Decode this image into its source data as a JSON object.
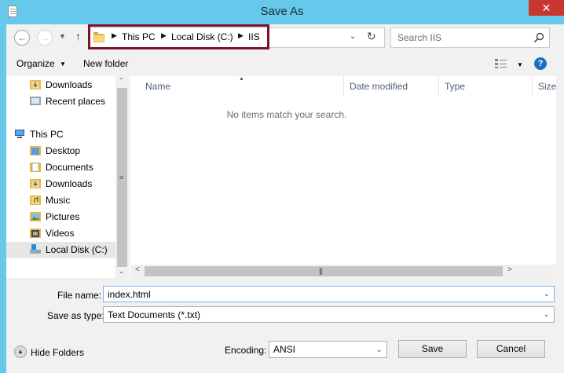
{
  "window": {
    "title": "Save As",
    "close_symbol": "✕"
  },
  "nav": {
    "back_icon": "back-arrow-icon",
    "forward_icon": "forward-arrow-icon",
    "up_symbol": "↑"
  },
  "address": {
    "crumbs": [
      "This PC",
      "Local Disk (C:)",
      "IIS"
    ],
    "separator": "▶"
  },
  "search": {
    "placeholder": "Search IIS"
  },
  "toolbar": {
    "organize_label": "Organize",
    "new_folder_label": "New folder",
    "help_symbol": "?"
  },
  "sidebar": {
    "items": [
      {
        "label": "Downloads",
        "icon": "downloads-folder-icon"
      },
      {
        "label": "Recent places",
        "icon": "recent-places-icon"
      },
      {
        "label": "This PC",
        "icon": "computer-icon"
      },
      {
        "label": "Desktop",
        "icon": "folder-icon"
      },
      {
        "label": "Documents",
        "icon": "documents-folder-icon"
      },
      {
        "label": "Downloads",
        "icon": "downloads-folder-icon"
      },
      {
        "label": "Music",
        "icon": "music-folder-icon"
      },
      {
        "label": "Pictures",
        "icon": "pictures-folder-icon"
      },
      {
        "label": "Videos",
        "icon": "videos-folder-icon"
      },
      {
        "label": "Local Disk (C:)",
        "icon": "drive-icon"
      }
    ],
    "selected": "Local Disk (C:)"
  },
  "files": {
    "columns": [
      "Name",
      "Date modified",
      "Type",
      "Size"
    ],
    "empty_message": "No items match your search."
  },
  "form": {
    "filename_label": "File name:",
    "filename_value": "index.html",
    "savetype_label": "Save as type:",
    "savetype_value": "Text Documents (*.txt)",
    "encoding_label": "Encoding:",
    "encoding_value": "ANSI",
    "save_label": "Save",
    "cancel_label": "Cancel",
    "hide_folders_label": "Hide Folders"
  },
  "colors": {
    "titlebar": "#66c8ea",
    "close": "#c7372f",
    "address_highlight": "#7b1526",
    "selection": "#e6e6e6"
  }
}
